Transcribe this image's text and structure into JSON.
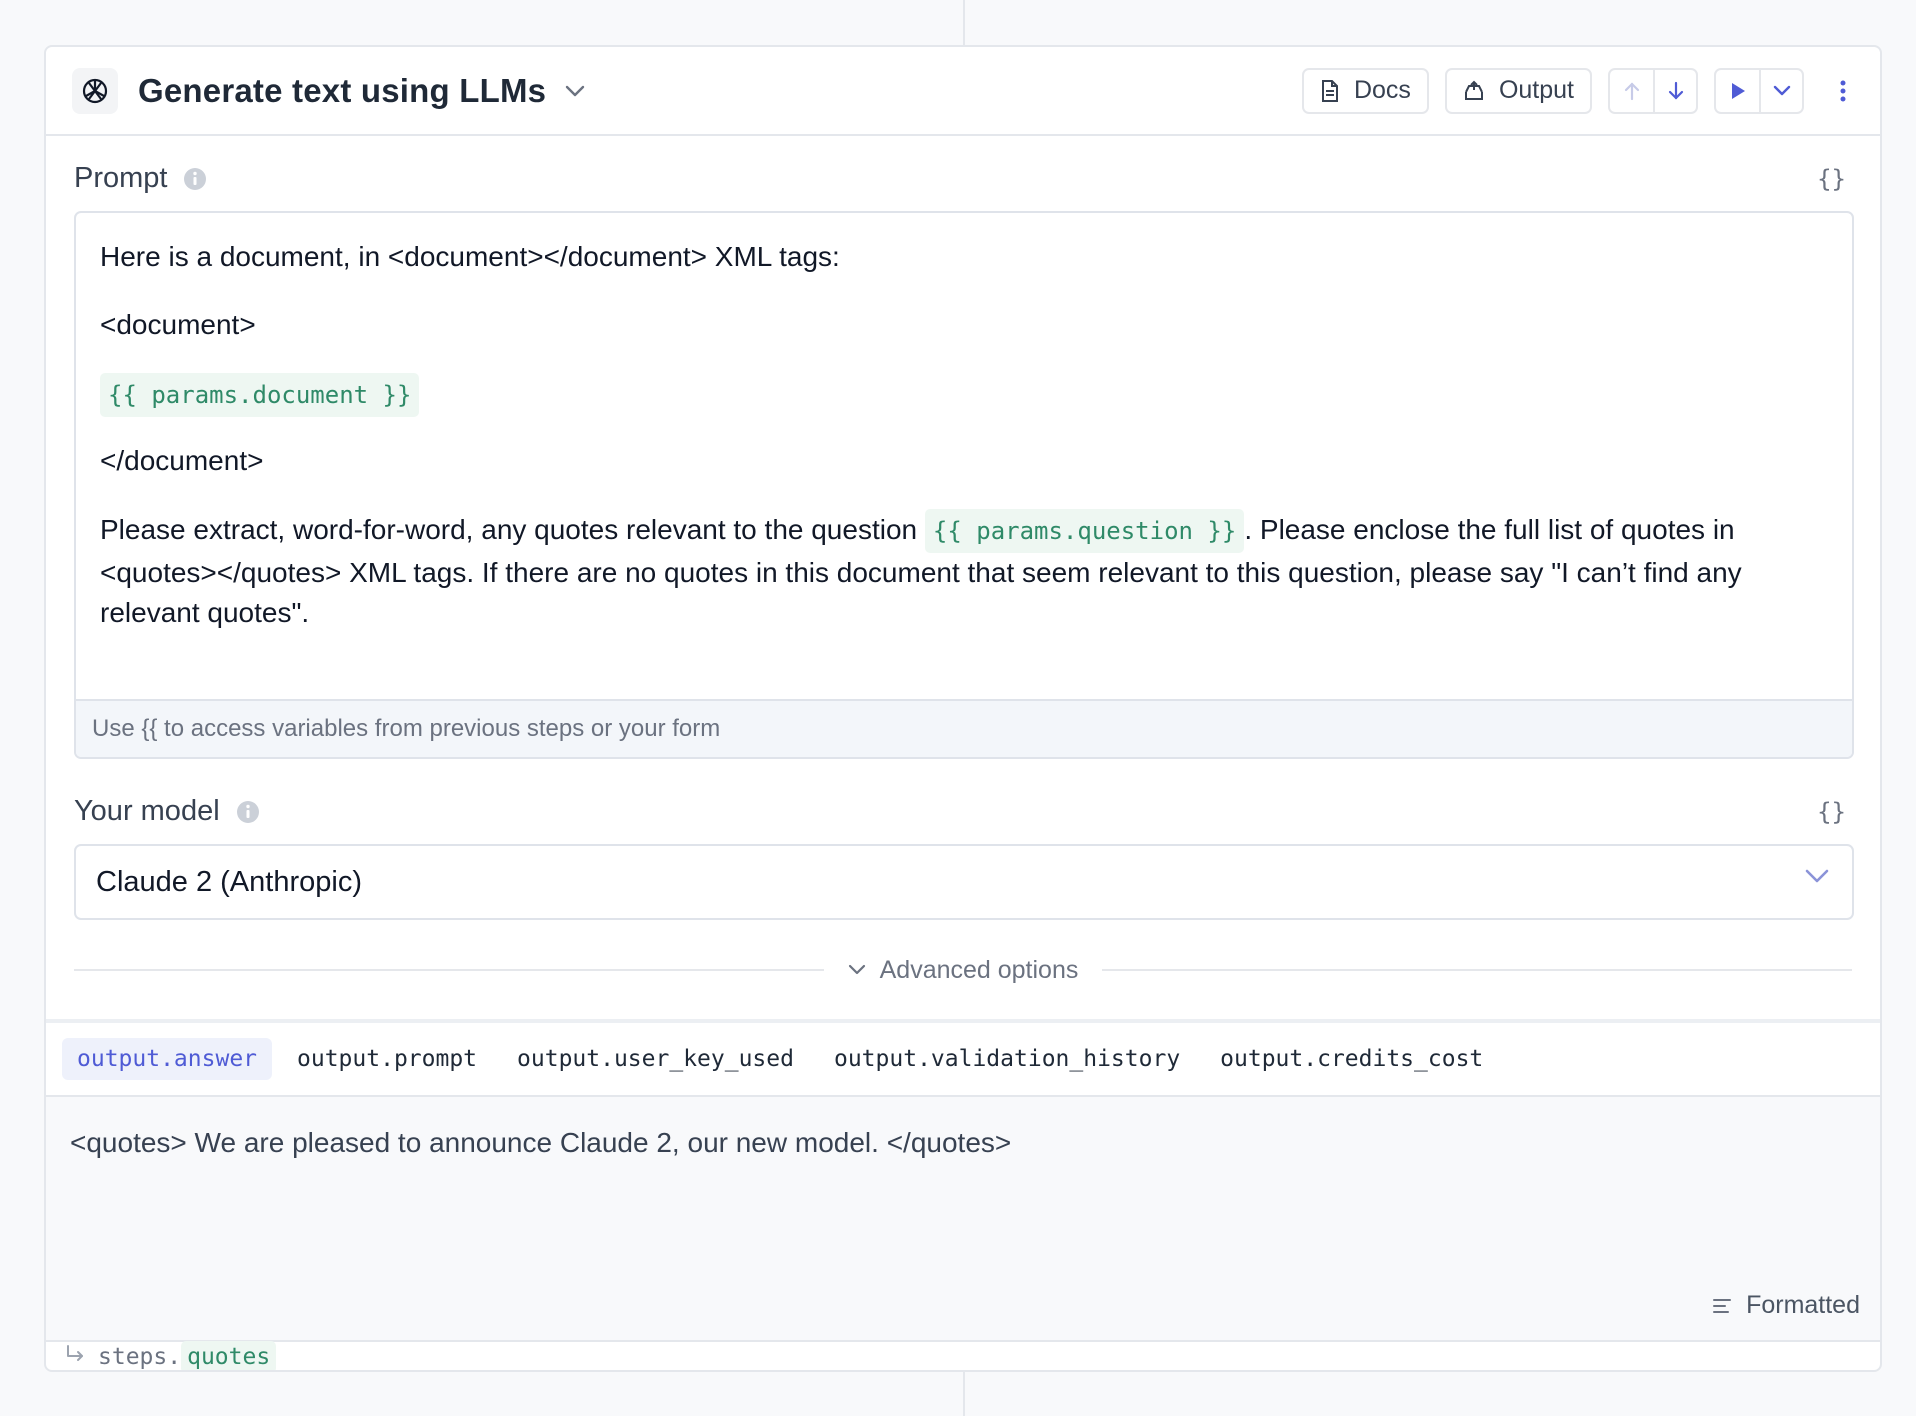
{
  "header": {
    "title": "Generate text using LLMs",
    "docs_label": "Docs",
    "output_label": "Output"
  },
  "prompt": {
    "label": "Prompt",
    "braces": "{}",
    "line1": "Here is a document, in <document></document> XML tags:",
    "line2": "<document>",
    "var_document": "{{ params.document }}",
    "line4": "</document>",
    "line5_before": "Please extract, word-for-word, any quotes relevant to the question ",
    "var_question": "{{ params.question }}",
    "line5_after": ". Please enclose the full list of quotes in <quotes></quotes> XML tags. If there are no quotes in this document that seem relevant to this question, please say \"I can’t find any relevant quotes\".",
    "hint": "Use {{ to access variables from previous steps or your form"
  },
  "model": {
    "label": "Your model",
    "braces": "{}",
    "selected": "Claude 2 (Anthropic)"
  },
  "advanced_label": "Advanced options",
  "output": {
    "tabs": [
      {
        "label": "output.answer",
        "active": true
      },
      {
        "label": "output.prompt",
        "active": false
      },
      {
        "label": "output.user_key_used",
        "active": false
      },
      {
        "label": "output.validation_history",
        "active": false
      },
      {
        "label": "output.credits_cost",
        "active": false
      }
    ],
    "text": "<quotes> We are pleased to announce Claude 2, our new model. </quotes>",
    "formatted_label": "Formatted"
  },
  "steps": {
    "prefix": "steps.",
    "key": "quotes"
  },
  "colors": {
    "accent": "#4f5bd5",
    "variable_green": "#2f8a68",
    "border": "#e4e7ec"
  }
}
